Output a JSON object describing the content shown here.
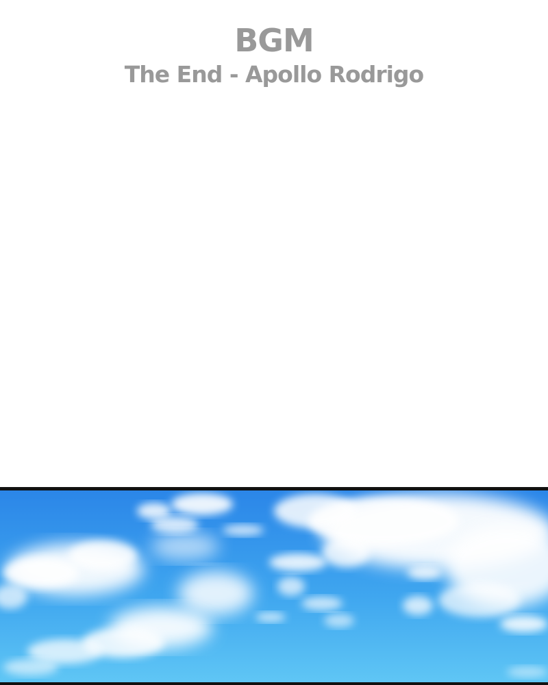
{
  "header": {
    "bgm_label": "BGM",
    "track_title": "The End - Apollo Rodrigo"
  },
  "panel": {
    "scene": "sky-with-clouds",
    "colors": {
      "sky_top": "#2b86e8",
      "sky_bottom": "#5fc6f5",
      "cloud": "#ffffff",
      "border": "#111111",
      "text": "#999999"
    }
  }
}
